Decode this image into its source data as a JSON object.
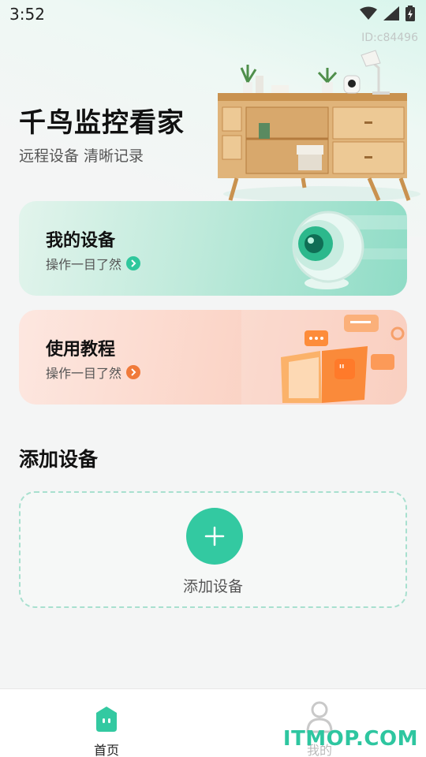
{
  "status_bar": {
    "time": "3:52",
    "icons": [
      "wifi-icon",
      "signal-icon",
      "battery-charging-icon"
    ]
  },
  "device_id": "ID:c84496",
  "hero": {
    "title": "千鸟监控看家",
    "subtitle": "远程设备 清晰记录"
  },
  "cards": [
    {
      "title": "我的设备",
      "subtitle": "操作一目了然",
      "accent": "#2fc79c"
    },
    {
      "title": "使用教程",
      "subtitle": "操作一目了然",
      "accent": "#f07a3a"
    }
  ],
  "add_section": {
    "title": "添加设备",
    "button_label": "添加设备",
    "accent": "#33c9a1"
  },
  "bottom_nav": {
    "home": "首页",
    "mine": "我的"
  },
  "watermark": "ITMOP.COM"
}
